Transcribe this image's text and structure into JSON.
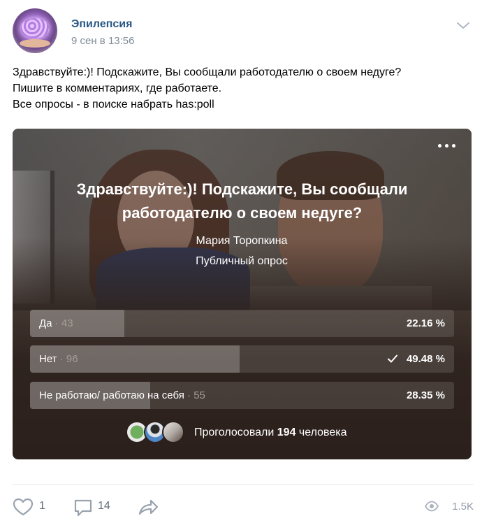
{
  "post": {
    "group_name": "Эпилепсия",
    "time": "9 сен в 13:56",
    "text_lines": [
      "Здравствуйте:)! Подскажите, Вы сообщали работодателю о своем недуге?",
      "Пишите в комментариях, где работаете.",
      "Все опросы - в поиске набрать has:poll"
    ]
  },
  "poll": {
    "question_lines": [
      "Здравствуйте:)! Подскажите, Вы сообщали",
      "работодателю о своем недуге?"
    ],
    "author": "Мария Торопкина",
    "type": "Публичный опрос",
    "answers": [
      {
        "text": "Да",
        "count": "· 43",
        "percent": "22.16 %",
        "fraction": 0.2216,
        "chosen": false
      },
      {
        "text": "Нет",
        "count": "· 96",
        "percent": "49.48 %",
        "fraction": 0.4948,
        "chosen": true
      },
      {
        "text": "Не работаю/ работаю на себя",
        "count": "· 55",
        "percent": "28.35 %",
        "fraction": 0.2835,
        "chosen": false
      }
    ],
    "votes_prefix": "Проголосовали",
    "votes_count": "194",
    "votes_suffix": "человека"
  },
  "footer": {
    "likes": "1",
    "comments": "14",
    "views": "1.5K"
  },
  "colors": {
    "link": "#2a5885",
    "muted": "#818c99",
    "icon": "#99a2ad"
  },
  "icons": {
    "menu": "chevron-down-icon",
    "poll_menu": "more-horizontal-icon",
    "like": "heart-icon",
    "comment": "comment-icon",
    "share": "share-arrow-icon",
    "views": "eye-icon",
    "check": "check-icon"
  }
}
